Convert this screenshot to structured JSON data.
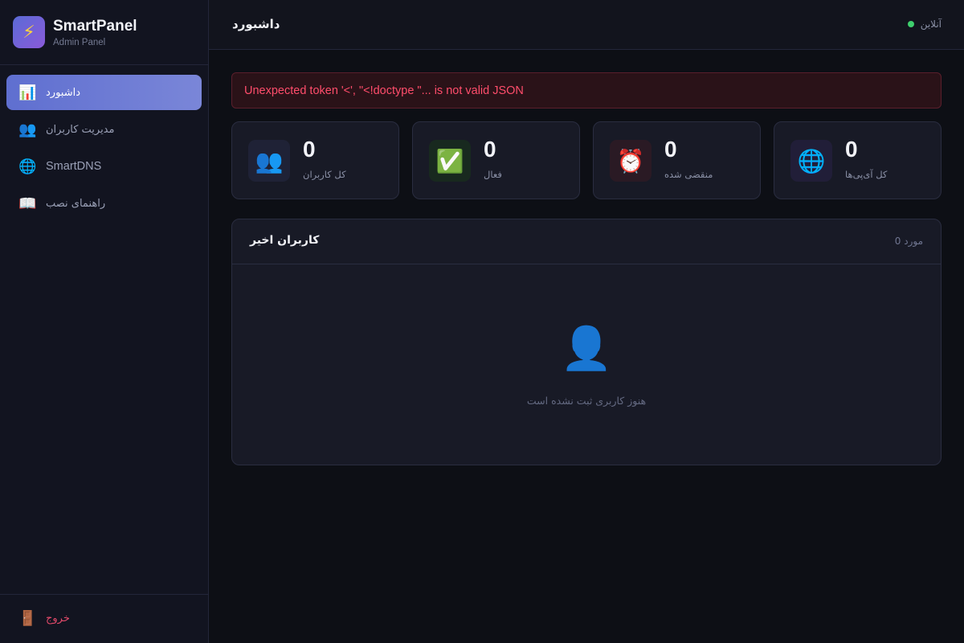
{
  "brand": {
    "logo_icon": "⚡",
    "name": "SmartPanel",
    "subtitle": "Admin Panel"
  },
  "sidebar": {
    "items": [
      {
        "icon": "📊",
        "label": "داشبورد",
        "active": true
      },
      {
        "icon": "👥",
        "label": "مدیریت کاربران",
        "active": false
      },
      {
        "icon": "🌐",
        "label": "SmartDNS",
        "active": false
      },
      {
        "icon": "📖",
        "label": "راهنمای نصب",
        "active": false
      }
    ],
    "logout": {
      "icon": "🚪",
      "label": "خروج"
    }
  },
  "header": {
    "title": "داشبورد",
    "status": "آنلاین",
    "status_color": "#3ecf6d"
  },
  "error": {
    "message": "Unexpected token '<', \"<!doctype \"... is not valid JSON"
  },
  "stats": [
    {
      "icon": "👥",
      "value": "0",
      "label": "کل کاربران"
    },
    {
      "icon": "✅",
      "value": "0",
      "label": "فعال"
    },
    {
      "icon": "⏰",
      "value": "0",
      "label": "منقضی شده"
    },
    {
      "icon": "🌐",
      "value": "0",
      "label": "کل آی‌پی‌ها"
    }
  ],
  "recent_users": {
    "title": "کاربران اخیر",
    "count": "0 مورد",
    "empty_icon": "👤",
    "empty_text": "هنوز کاربری ثبت نشده است"
  },
  "colors": {
    "accent": "#6a78d6",
    "danger": "#ff4d6b",
    "background": "#0d0f15"
  }
}
